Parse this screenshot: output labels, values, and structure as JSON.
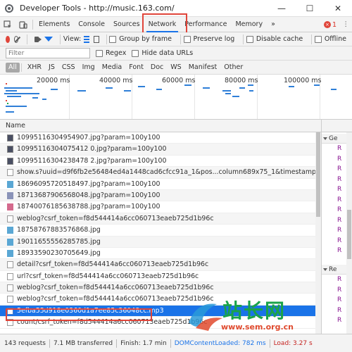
{
  "window": {
    "title": "Developer Tools - http://music.163.com/",
    "minimize": "—",
    "maximize": "☐",
    "close": "✕"
  },
  "tabs": [
    "Elements",
    "Console",
    "Sources",
    "Network",
    "Performance",
    "Memory"
  ],
  "tab_overflow": "»",
  "error_count": "1",
  "more_menu": "⋮",
  "toolbar": {
    "view_label": "View:",
    "group_by_frame": "Group by frame",
    "preserve_log": "Preserve log",
    "disable_cache": "Disable cache",
    "offline": "Offline"
  },
  "filter": {
    "placeholder": "Filter",
    "regex": "Regex",
    "hide_data_urls": "Hide data URLs"
  },
  "type_filters": [
    "All",
    "XHR",
    "JS",
    "CSS",
    "Img",
    "Media",
    "Font",
    "Doc",
    "WS",
    "Manifest",
    "Other"
  ],
  "overview": {
    "ticks": [
      "20000 ms",
      "40000 ms",
      "60000 ms",
      "80000 ms",
      "100000 ms"
    ]
  },
  "list": {
    "column_name": "Name",
    "close": "×",
    "rows": [
      {
        "name": "10995116304954907.jpg?param=100y100",
        "icon": "image-dark-icon"
      },
      {
        "name": "10995116304075412 0.jpg?param=100y100",
        "icon": "image-dark-icon"
      },
      {
        "name": "10995116304238478 2.jpg?param=100y100",
        "icon": "image-dark-icon"
      },
      {
        "name": "show.s?uuid=d9f6fb2e56484ed4a1448cad6cfcc91a_1&pos...column689x75_1&timestamp=15089184",
        "icon": "document-icon"
      },
      {
        "name": "18696095720518497.jpg?param=100y100",
        "icon": "image-blue-icon"
      },
      {
        "name": "18713687906568048.jpg?param=100y100",
        "icon": "image-purple-icon"
      },
      {
        "name": "18740076185638788.jpg?param=100y100",
        "icon": "image-pink-icon"
      },
      {
        "name": "weblog?csrf_token=f8d544414a6cc060713eaeb725d1b96c",
        "icon": "document-icon"
      },
      {
        "name": "18758767883576868.jpg",
        "icon": "image-blue-icon"
      },
      {
        "name": "19011655556285785.jpg",
        "icon": "image-blue-icon"
      },
      {
        "name": "18933590230705649.jpg",
        "icon": "image-blue-icon"
      },
      {
        "name": "detail?csrf_token=f8d544414a6cc060713eaeb725d1b96c",
        "icon": "document-icon"
      },
      {
        "name": "url?csrf_token=f8d544414a6cc060713eaeb725d1b96c",
        "icon": "document-icon"
      },
      {
        "name": "weblog?csrf_token=f8d544414a6cc060713eaeb725d1b96c",
        "icon": "document-icon"
      },
      {
        "name": "weblog?csrf_token=f8d544414a6cc060713eaeb725d1b96c",
        "icon": "document-icon"
      },
      {
        "name": "5efba55d918e0360d1a7ee85c36048cc.mp3",
        "icon": "media-icon",
        "selected": true
      },
      {
        "name": "count/csrf_token=f8d544414a6cc060713eaeb725d1b96c",
        "icon": "document-icon"
      }
    ]
  },
  "sidebar": {
    "section1": "Ge",
    "section2": "Re",
    "r_letter": "R"
  },
  "status": {
    "requests": "143 requests",
    "transferred": "7.1 MB transferred",
    "finish": "Finish: 1.7 min",
    "dcl": "DOMContentLoaded: 782 ms",
    "load": "Load: 3.27 s"
  },
  "watermark": {
    "text": "站长网",
    "url": "www.sem.org.cn"
  },
  "colors": {
    "accent": "#1a73e8",
    "highlight_box": "#e0453a",
    "record": "#e0453a"
  }
}
